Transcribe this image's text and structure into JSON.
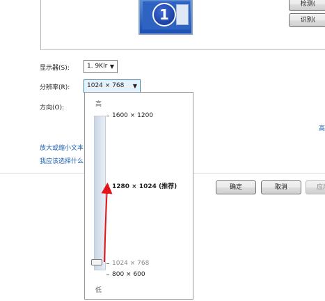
{
  "top_buttons": {
    "detect": "检测(",
    "identify": "识别("
  },
  "monitor": {
    "number": "1"
  },
  "display": {
    "label": "显示器(S):",
    "value": "1. 9Klr"
  },
  "resolution": {
    "label": "分辨率(R):",
    "value": "1024 × 768"
  },
  "orientation": {
    "label": "方向(O):"
  },
  "links": {
    "enlarge": "放大或缩小文本",
    "choose": "我应该选择什么",
    "advanced": "高"
  },
  "slider": {
    "high": "高",
    "low": "低",
    "options": [
      "1600 × 1200",
      "1280 × 1024 (推荐)",
      "1024 × 768",
      "800 × 600"
    ],
    "selected_index": 2
  },
  "footer": {
    "ok": "确定",
    "cancel": "取消",
    "apply": "应用"
  },
  "colors": {
    "accent_arrow": "#e3151a",
    "link": "#1a5fb4"
  }
}
